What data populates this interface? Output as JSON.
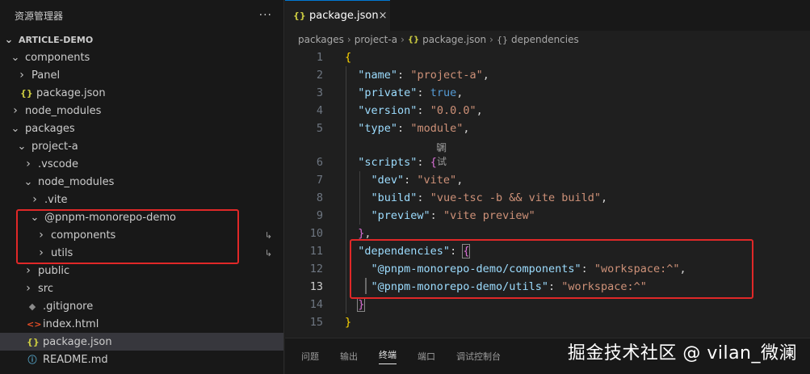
{
  "sidebar": {
    "title": "资源管理器",
    "more": "···",
    "tree": [
      {
        "label": "ARTICLE-DEMO",
        "chev": "down",
        "icon": "",
        "indent": 0,
        "root": true
      },
      {
        "label": "components",
        "chev": "down",
        "icon": "",
        "indent": 1
      },
      {
        "label": "Panel",
        "chev": "right",
        "icon": "",
        "indent": 2
      },
      {
        "label": "package.json",
        "chev": "",
        "icon": "json",
        "indent": 2
      },
      {
        "label": "node_modules",
        "chev": "right",
        "icon": "",
        "indent": 1
      },
      {
        "label": "packages",
        "chev": "down",
        "icon": "",
        "indent": 1
      },
      {
        "label": "project-a",
        "chev": "down",
        "icon": "",
        "indent": 2
      },
      {
        "label": ".vscode",
        "chev": "right",
        "icon": "",
        "indent": 3
      },
      {
        "label": "node_modules",
        "chev": "down",
        "icon": "",
        "indent": 3
      },
      {
        "label": ".vite",
        "chev": "right",
        "icon": "",
        "indent": 4
      },
      {
        "label": "@pnpm-monorepo-demo",
        "chev": "down",
        "icon": "",
        "indent": 4
      },
      {
        "label": "components",
        "chev": "right",
        "icon": "",
        "indent": 5,
        "link": true
      },
      {
        "label": "utils",
        "chev": "right",
        "icon": "",
        "indent": 5,
        "link": true
      },
      {
        "label": "public",
        "chev": "right",
        "icon": "",
        "indent": 3
      },
      {
        "label": "src",
        "chev": "right",
        "icon": "",
        "indent": 3
      },
      {
        "label": ".gitignore",
        "chev": "",
        "icon": "git",
        "indent": 3
      },
      {
        "label": "index.html",
        "chev": "",
        "icon": "html",
        "indent": 3
      },
      {
        "label": "package.json",
        "chev": "",
        "icon": "json",
        "indent": 3,
        "selected": true
      },
      {
        "label": "README.md",
        "chev": "",
        "icon": "info",
        "indent": 3
      }
    ]
  },
  "editor": {
    "tab": {
      "label": "package.json",
      "close": "×",
      "icon": "{}"
    },
    "breadcrumb": [
      "packages",
      "project-a",
      "package.json",
      "dependencies"
    ],
    "codelens": "调试",
    "active_line": 13
  },
  "panel": {
    "tabs": [
      "问题",
      "输出",
      "终端",
      "端口",
      "调试控制台"
    ],
    "active": "终端"
  },
  "watermark": "掘金技术社区 @ vilan_微澜",
  "colors": {
    "highlight": "#e02828",
    "accent": "#0078d4"
  }
}
